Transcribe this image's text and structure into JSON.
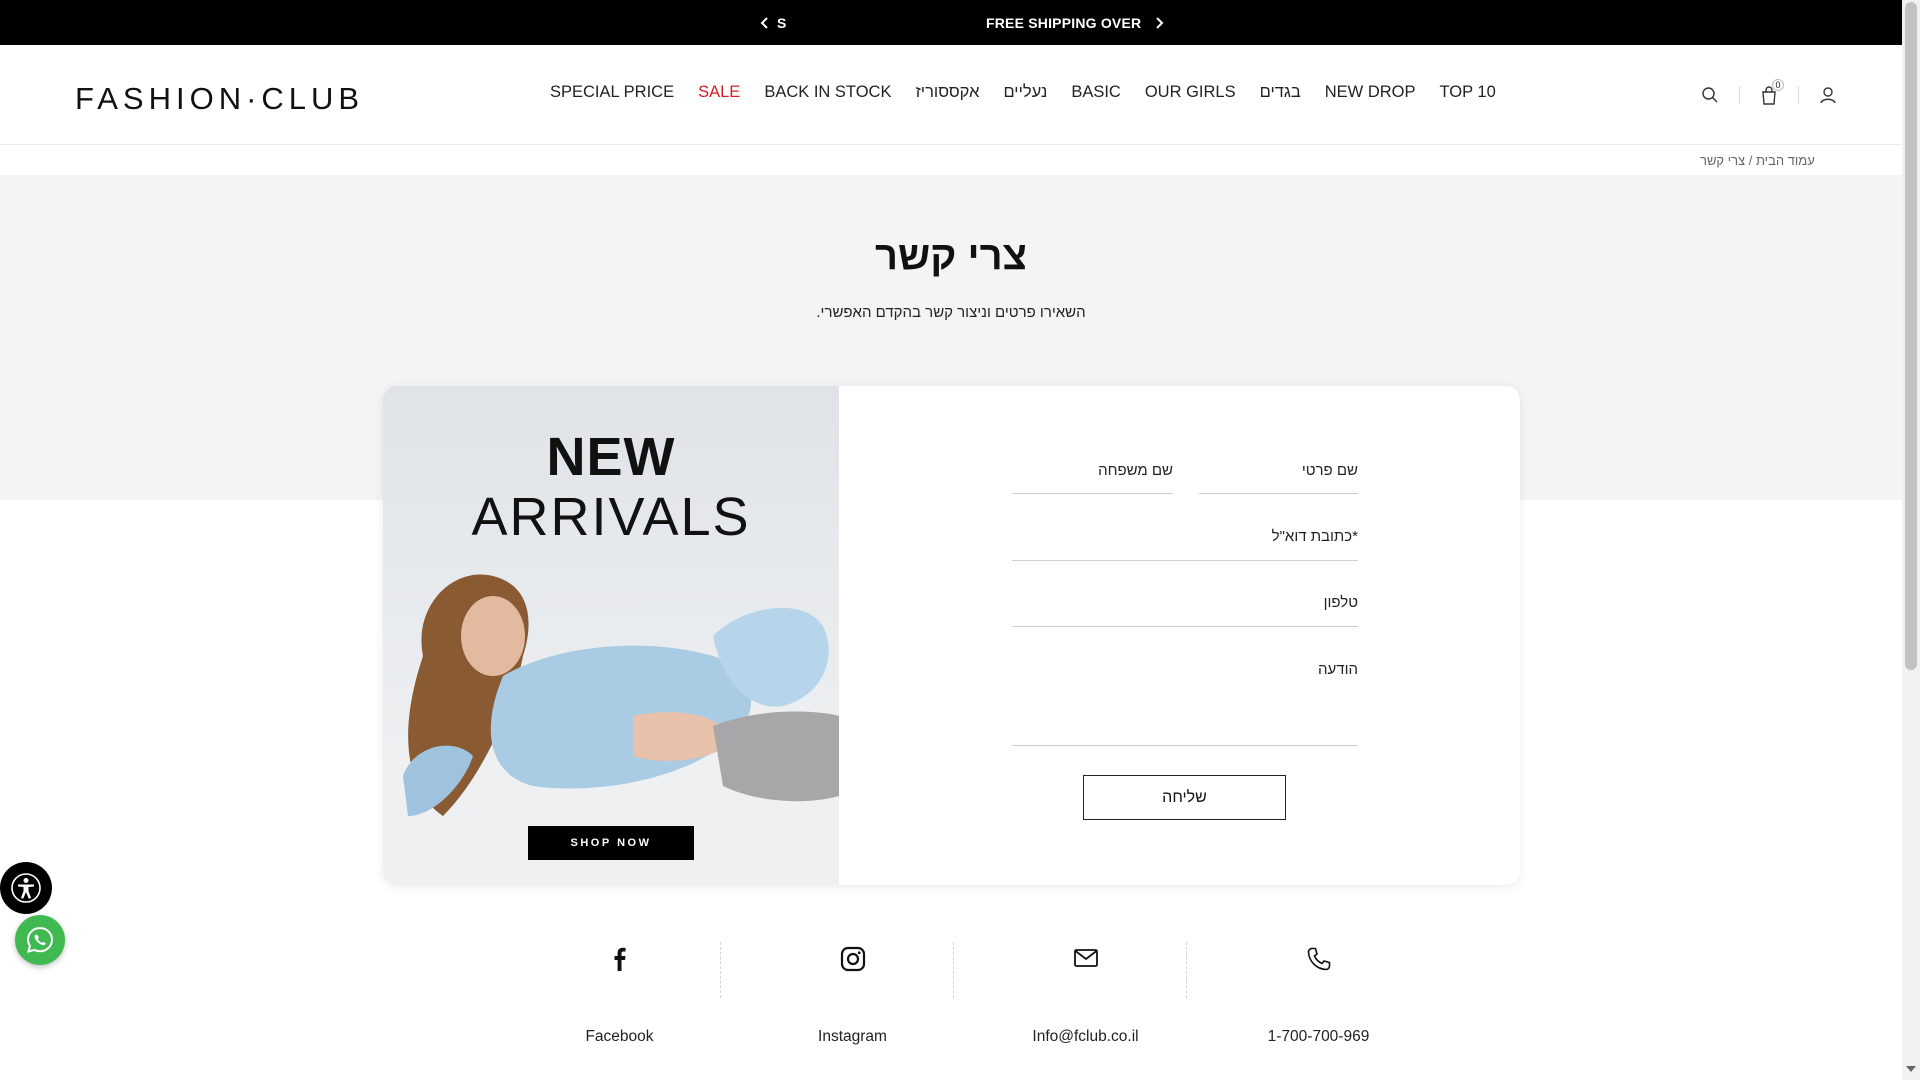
{
  "topbar": {
    "left_text": "S",
    "right_text": "FREE SHIPPING OVER",
    "prev_icon": "chevron-left-icon",
    "next_icon": "chevron-right-icon"
  },
  "header": {
    "logo": "FASHION·CLUB",
    "nav": [
      {
        "label": "SPECIAL PRICE",
        "name": "special-price"
      },
      {
        "label": "SALE",
        "name": "sale",
        "color": "#d31f26"
      },
      {
        "label": "BACK IN STOCK",
        "name": "back-in-stock"
      },
      {
        "label": "אקססוריז",
        "name": "accessories"
      },
      {
        "label": "נעליים",
        "name": "shoes"
      },
      {
        "label": "BASIC",
        "name": "basic"
      },
      {
        "label": "OUR GIRLS",
        "name": "our-girls"
      },
      {
        "label": "בגדים",
        "name": "clothes"
      },
      {
        "label": "NEW DROP",
        "name": "new-drop"
      },
      {
        "label": "TOP 10",
        "name": "top-10"
      }
    ],
    "cart_count": "0",
    "icons": [
      "search-icon",
      "cart-icon",
      "user-icon"
    ]
  },
  "breadcrumb": "עמוד הבית / צרי קשר",
  "page": {
    "title": "צרי קשר",
    "subtitle": "השאירו פרטים וניצור קשר בהקדם האפשרי."
  },
  "promo": {
    "line1": "NEW",
    "line2": "ARRIVALS",
    "cta": "SHOP NOW"
  },
  "form": {
    "first_name": "שם פרטי",
    "last_name": "שם משפחה",
    "email": "*כתובת דוא\"ל",
    "phone": "טלפון",
    "message": "הודעה",
    "submit": "שליחה"
  },
  "contacts": [
    {
      "label": "Facebook",
      "icon": "facebook-icon"
    },
    {
      "label": "Instagram",
      "icon": "instagram-icon"
    },
    {
      "label": "Info@fclub.co.il",
      "icon": "mail-icon"
    },
    {
      "label": "1-700-700-969",
      "icon": "phone-icon"
    }
  ],
  "floating": [
    "accessibility-icon",
    "whatsapp-icon"
  ],
  "colors": {
    "accent_sale": "#d31f26",
    "topbar": "#000000",
    "hero_bg": "#f4f4f4",
    "whatsapp": "#3fb950"
  }
}
